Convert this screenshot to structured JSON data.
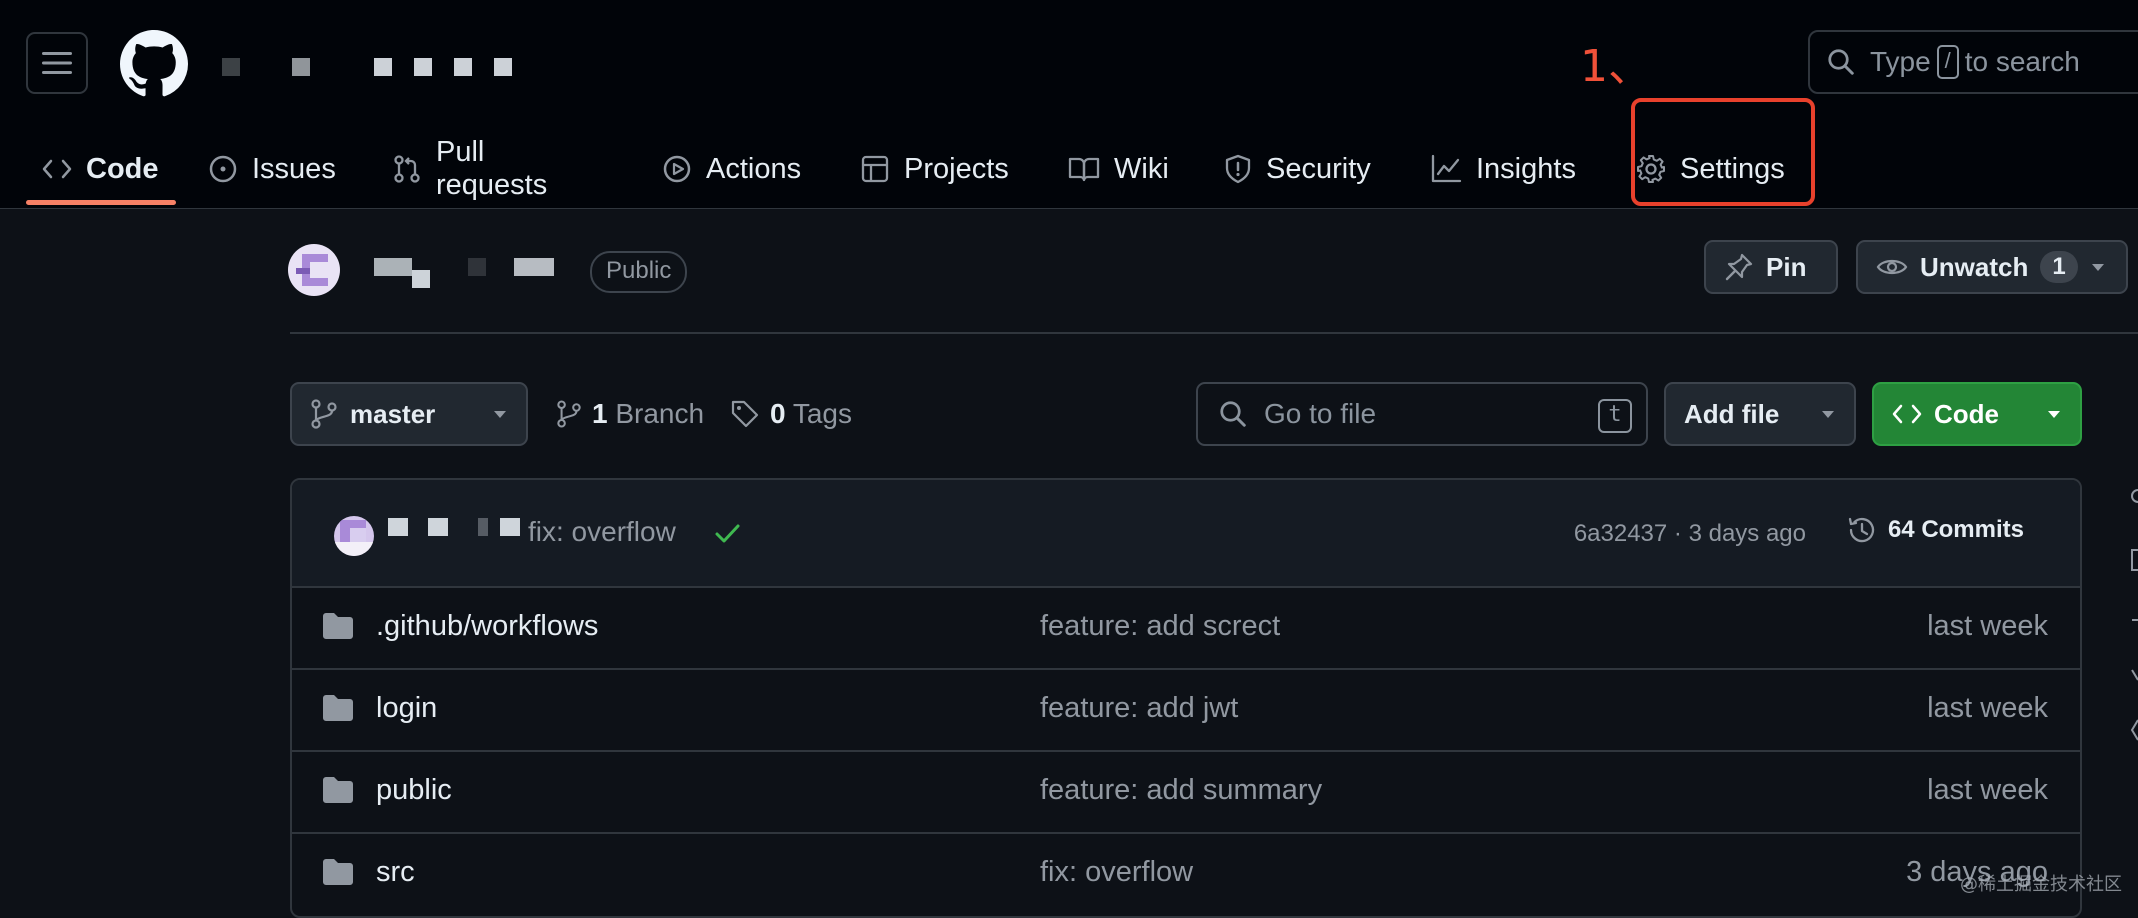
{
  "header": {
    "annotation": "1、",
    "search_prefix": "Type",
    "search_key": "/",
    "search_suffix": "to search"
  },
  "nav": {
    "tabs": [
      {
        "label": "Code",
        "icon": "code-icon"
      },
      {
        "label": "Issues",
        "icon": "issue-icon"
      },
      {
        "label": "Pull requests",
        "icon": "pull-request-icon"
      },
      {
        "label": "Actions",
        "icon": "play-icon"
      },
      {
        "label": "Projects",
        "icon": "table-icon"
      },
      {
        "label": "Wiki",
        "icon": "book-icon"
      },
      {
        "label": "Security",
        "icon": "shield-icon"
      },
      {
        "label": "Insights",
        "icon": "graph-icon"
      },
      {
        "label": "Settings",
        "icon": "gear-icon"
      }
    ]
  },
  "repo": {
    "visibility": "Public",
    "pin_label": "Pin",
    "unwatch_label": "Unwatch",
    "watch_count": "1"
  },
  "toolbar": {
    "branch": "master",
    "branch_count": "1",
    "branch_label": "Branch",
    "tag_count": "0",
    "tag_label": "Tags",
    "goto_placeholder": "Go to file",
    "goto_key": "t",
    "addfile_label": "Add file",
    "code_label": "Code"
  },
  "latest_commit": {
    "message": "fix: overflow",
    "meta": "6a32437 · 3 days ago",
    "commits_label": "64 Commits"
  },
  "files": [
    {
      "name": ".github/workflows",
      "commit": "feature: add screct",
      "date": "last week"
    },
    {
      "name": "login",
      "commit": "feature: add jwt",
      "date": "last week"
    },
    {
      "name": "public",
      "commit": "feature: add summary",
      "date": "last week"
    },
    {
      "name": "src",
      "commit": "fix: overflow",
      "date": "3 days ago"
    }
  ],
  "watermark": "@稀土掘金技术社区",
  "colors": {
    "background": "#0d1117",
    "header": "#010409",
    "accent_underline": "#f78166",
    "highlight_box": "#e8412c",
    "code_button": "#238636"
  }
}
